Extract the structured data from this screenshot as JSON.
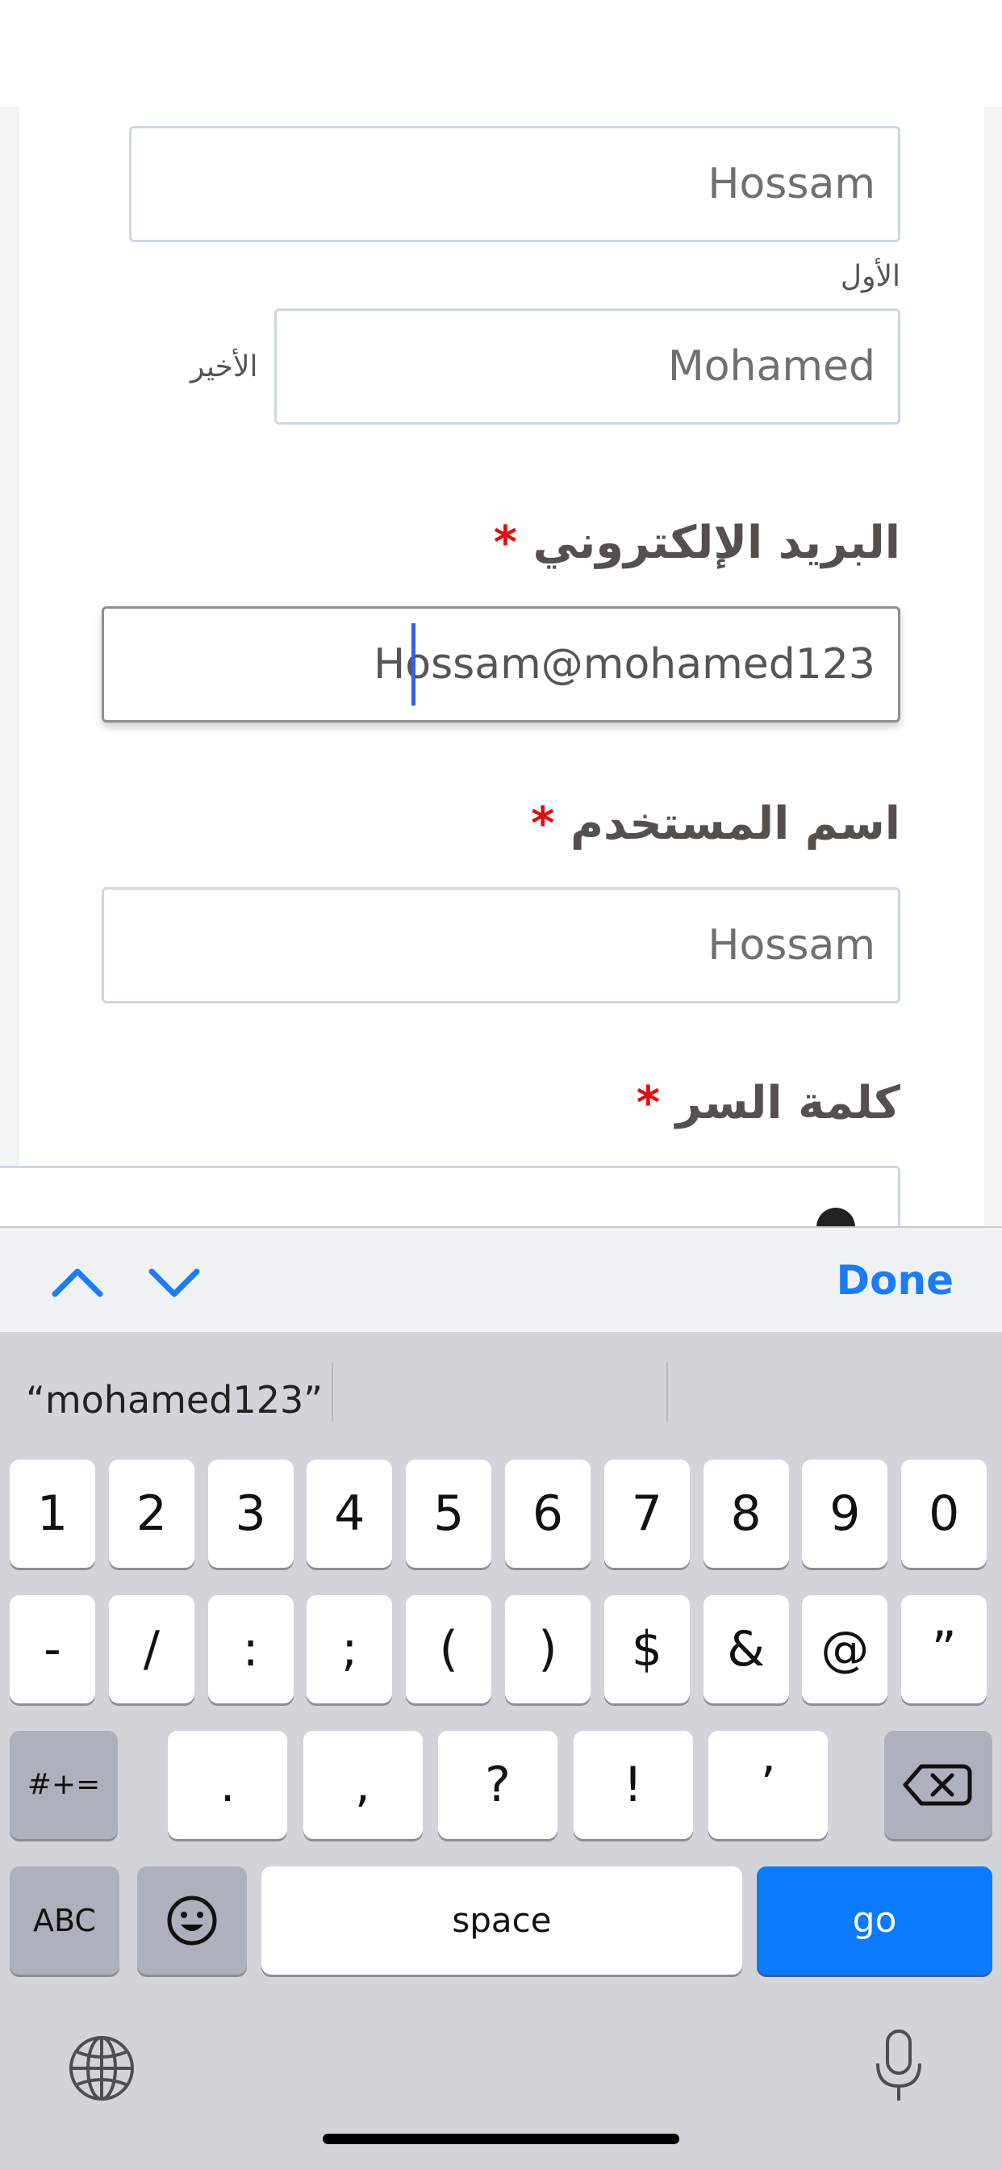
{
  "form": {
    "first_name_value": "Hossam",
    "first_label": "الأول",
    "last_name_value": "Mohamed",
    "last_label": "الأخير",
    "email_label": "البريد الإلكتروني",
    "email_value": "Hossam@mohamed123",
    "username_label": "اسم المستخدم",
    "username_value": "Hossam",
    "password_label": "كلمة السر",
    "required_mark": "*"
  },
  "accessory": {
    "prev_icon": "chevron-up-icon",
    "next_icon": "chevron-down-icon",
    "done_label": "Done"
  },
  "keyboard": {
    "suggestion": "“mohamed123”",
    "row1": [
      "1",
      "2",
      "3",
      "4",
      "5",
      "6",
      "7",
      "8",
      "9",
      "0"
    ],
    "row2": [
      "-",
      "/",
      ":",
      ";",
      "(",
      ")",
      "$",
      "&",
      "@",
      "”"
    ],
    "row3": [
      ".",
      ",",
      "?",
      "!",
      "’"
    ],
    "symbols_label": "#+=",
    "abc_label": "ABC",
    "space_label": "space",
    "go_label": "go",
    "emoji_icon": "emoji-icon",
    "delete_icon": "delete-icon",
    "globe_icon": "globe-icon",
    "mic_icon": "microphone-icon"
  }
}
